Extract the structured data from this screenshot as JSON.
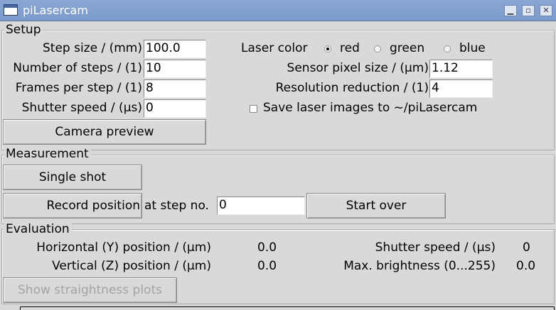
{
  "window": {
    "title": "piLasercam",
    "controls": [
      "minimize-icon",
      "maximize-icon",
      "close-icon"
    ]
  },
  "setup": {
    "label": "Setup",
    "step_size_label": "Step size / (mm)",
    "step_size_value": "100.0",
    "num_steps_label": "Number of steps / (1)",
    "num_steps_value": "10",
    "frames_label": "Frames per step / (1)",
    "frames_value": "8",
    "shutter_label": "Shutter speed / (µs)",
    "shutter_value": "0",
    "camera_preview": "Camera preview",
    "laser_color_label": "Laser color",
    "laser_colors": [
      {
        "label": "red",
        "selected": true
      },
      {
        "label": "green",
        "selected": false
      },
      {
        "label": "blue",
        "selected": false
      }
    ],
    "pixel_size_label": "Sensor pixel size / (µm)",
    "pixel_size_value": "1.12",
    "res_red_label": "Resolution reduction / (1)",
    "res_red_value": "4",
    "save_images_label": "Save laser images to ~/piLasercam",
    "save_images_checked": false
  },
  "measurement": {
    "label": "Measurement",
    "single_shot": "Single shot",
    "record_position": "Record position",
    "at_step_label": "at step no.",
    "step_no_value": "0",
    "start_over": "Start over"
  },
  "evaluation": {
    "label": "Evaluation",
    "horiz_label": "Horizontal (Y) position / (µm)",
    "horiz_value": "0.0",
    "vert_label": "Vertical (Z) position / (µm)",
    "vert_value": "0.0",
    "shutter_label": "Shutter speed / (µs)",
    "shutter_value": "0",
    "brightness_label": "Max. brightness (0...255)",
    "brightness_value": "0.0",
    "plots_button": "Show straightness plots"
  }
}
